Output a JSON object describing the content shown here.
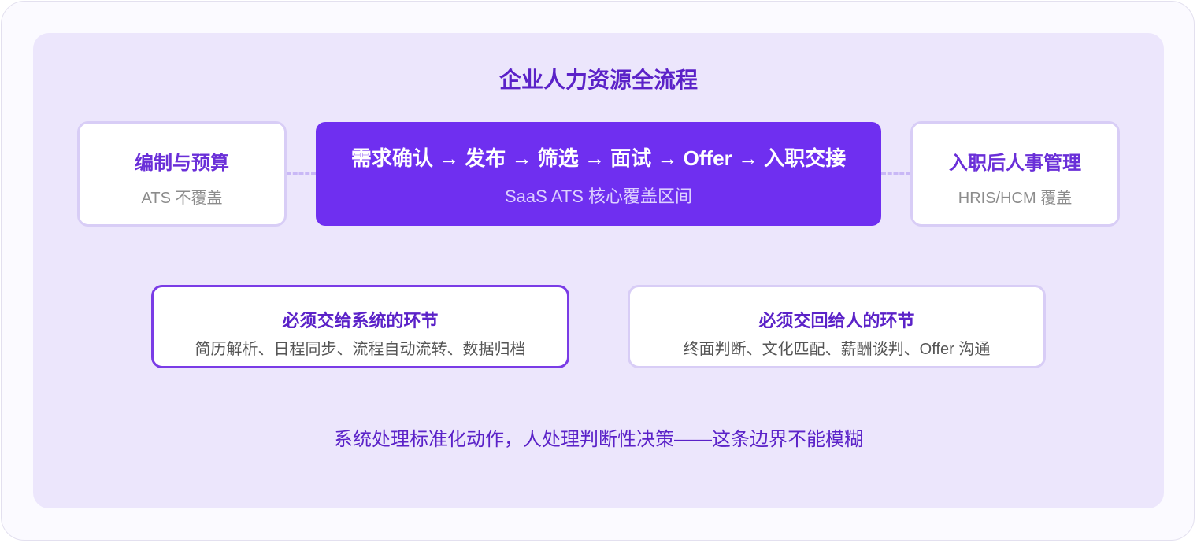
{
  "title": "企业人力资源全流程",
  "left_stage": {
    "title": "编制与预算",
    "subtitle": "ATS 不覆盖"
  },
  "core_stage": {
    "flow": "需求确认 → 发布 → 筛选 → 面试 → Offer → 入职交接",
    "subtitle": "SaaS ATS 核心覆盖区间"
  },
  "right_stage": {
    "title": "入职后人事管理",
    "subtitle": "HRIS/HCM 覆盖"
  },
  "system_box": {
    "title": "必须交给系统的环节",
    "items": "简历解析、日程同步、流程自动流转、数据归档"
  },
  "human_box": {
    "title": "必须交回给人的环节",
    "items": "终面判断、文化匹配、薪酬谈判、Offer 沟通"
  },
  "footer": "系统处理标准化动作，人处理判断性决策——这条边界不能模糊",
  "colors": {
    "accent": "#6f2ff0",
    "panel_bg": "#ece6fc",
    "title_purple": "#5b22c8",
    "border_light": "#d8cdf6"
  }
}
